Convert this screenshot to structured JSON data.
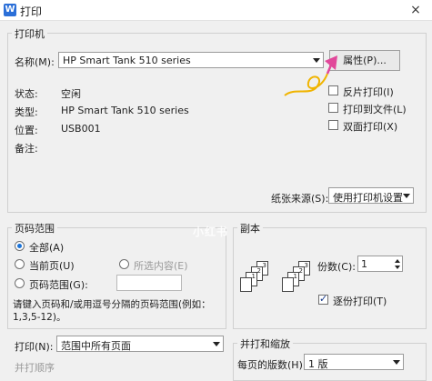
{
  "window": {
    "title": "打印",
    "app_icon_glyph": "W",
    "close_glyph": "×"
  },
  "printer": {
    "group_label": "打印机",
    "name_label": "名称(M):",
    "name_value": "HP Smart Tank 510 series",
    "properties_button": "属性(P)...",
    "status_label": "状态:",
    "status_value": "空闲",
    "type_label": "类型:",
    "type_value": "HP Smart Tank 510 series",
    "location_label": "位置:",
    "location_value": "USB001",
    "comment_label": "备注:",
    "reverse_print": "反片打印(I)",
    "print_to_file": "打印到文件(L)",
    "duplex": "双面打印(X)",
    "paper_source_label": "纸张来源(S):",
    "paper_source_value": "使用打印机设置"
  },
  "page_range": {
    "group_label": "页码范围",
    "all": "全部(A)",
    "current": "当前页(U)",
    "selection": "所选内容(E)",
    "pages": "页码范围(G):",
    "pages_value": "",
    "hint_line1": "请键入页码和/或用逗号分隔的页码范围(例如：",
    "hint_line2": "1,3,5-12)。"
  },
  "copies": {
    "group_label": "副本",
    "count_label": "份数(C):",
    "count_value": "1",
    "collate": "逐份打印(T)",
    "page_numbers": [
      "1",
      "2",
      "3"
    ]
  },
  "print_what": {
    "label": "打印(N):",
    "value": "范围中所有页面"
  },
  "order_label": "并打顺序",
  "zoom": {
    "group_label": "并打和缩放",
    "pages_per_sheet_label": "每页的版数(H):",
    "pages_per_sheet_value": "1 版"
  },
  "watermark": "小红书",
  "colors": {
    "accent": "#1a73d8",
    "annotation": "#e1479a",
    "annotation_loop": "#f0b400"
  }
}
